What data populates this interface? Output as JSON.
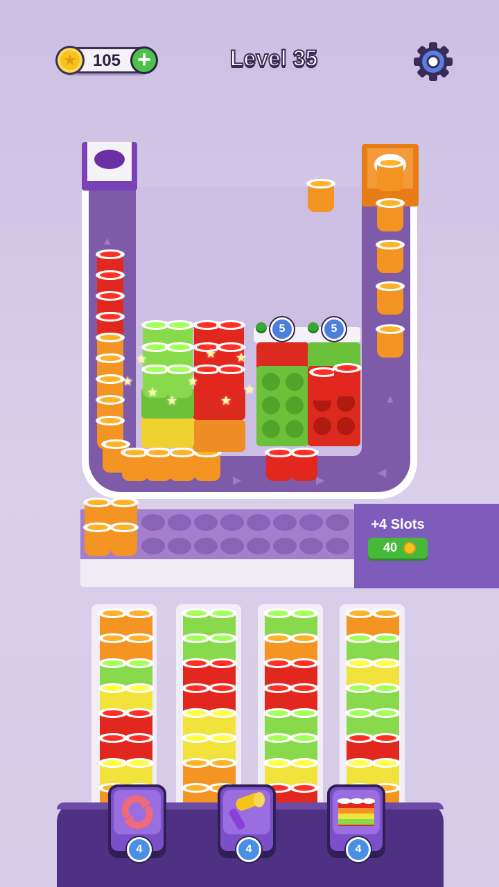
{
  "header": {
    "coins": "105",
    "level": "Level 35",
    "coin_icon": "coin-icon",
    "add_icon": "plus-icon",
    "settings_icon": "gear-icon"
  },
  "board": {
    "tray_badges": [
      "5",
      "5"
    ]
  },
  "slots": {
    "label": "+4 Slots",
    "price": "40"
  },
  "boosters": [
    {
      "name": "shuffle",
      "icon": "shuffle-icon",
      "count": "4"
    },
    {
      "name": "hammer",
      "icon": "hammer-icon",
      "count": "4"
    },
    {
      "name": "rainbow-cups",
      "icon": "rainbow-cups-icon",
      "count": "4"
    }
  ],
  "colors": {
    "red": "#e2271f",
    "orange": "#f49422",
    "green": "#88d94c",
    "yellow": "#f2e33c",
    "purple": "#7d5ba8"
  }
}
